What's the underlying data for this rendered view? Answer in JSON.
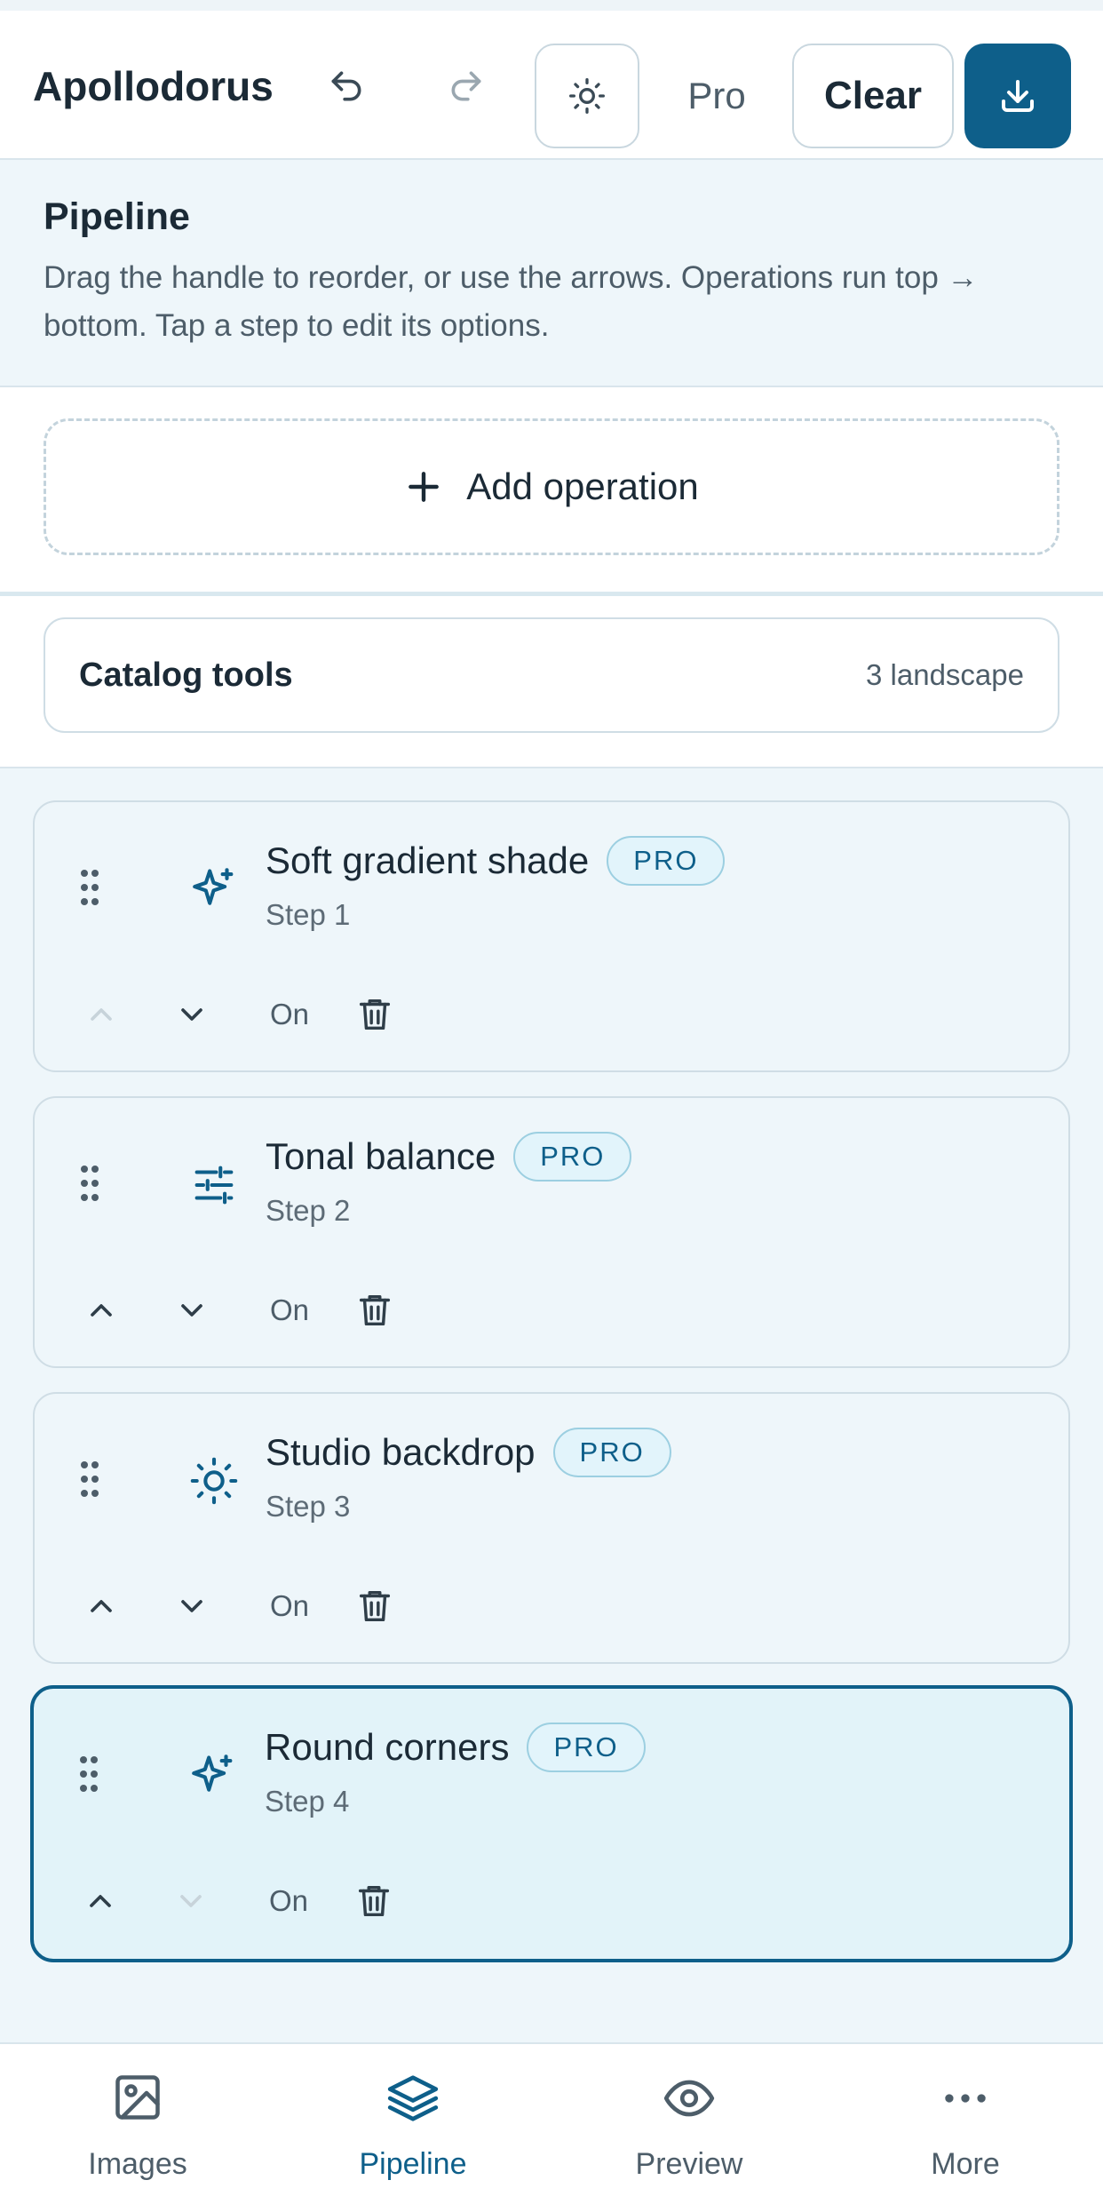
{
  "header": {
    "title": "Apollodorus",
    "pro_label": "Pro",
    "clear_label": "Clear"
  },
  "intro": {
    "heading": "Pipeline",
    "description": "Drag the handle to reorder, or use the arrows. Operations run top → bottom. Tap a step to edit its options."
  },
  "add_operation": {
    "label": "Add operation"
  },
  "catalog": {
    "label": "Catalog tools",
    "count": "3 landscape"
  },
  "steps": [
    {
      "name": "Soft gradient shade",
      "badge": "PRO",
      "sub": "Step 1",
      "toggle": "On",
      "icon": "sparkle-icon",
      "up_disabled": true,
      "down_disabled": false,
      "active": false
    },
    {
      "name": "Tonal balance",
      "badge": "PRO",
      "sub": "Step 2",
      "toggle": "On",
      "icon": "sliders-icon",
      "up_disabled": false,
      "down_disabled": false,
      "active": false
    },
    {
      "name": "Studio backdrop",
      "badge": "PRO",
      "sub": "Step 3",
      "toggle": "On",
      "icon": "sun-icon",
      "up_disabled": false,
      "down_disabled": false,
      "active": false
    },
    {
      "name": "Round corners",
      "badge": "PRO",
      "sub": "Step 4",
      "toggle": "On",
      "icon": "sparkle-icon",
      "up_disabled": false,
      "down_disabled": true,
      "active": true
    }
  ],
  "nav": {
    "items": [
      {
        "label": "Images",
        "icon": "image-icon",
        "active": false
      },
      {
        "label": "Pipeline",
        "icon": "layers-icon",
        "active": true
      },
      {
        "label": "Preview",
        "icon": "eye-icon",
        "active": false
      },
      {
        "label": "More",
        "icon": "more-dots-icon",
        "active": false
      }
    ]
  },
  "colors": {
    "accent": "#0e5f8a",
    "active_bg": "#e2f3f9",
    "panel_bg": "#eef6fa"
  }
}
